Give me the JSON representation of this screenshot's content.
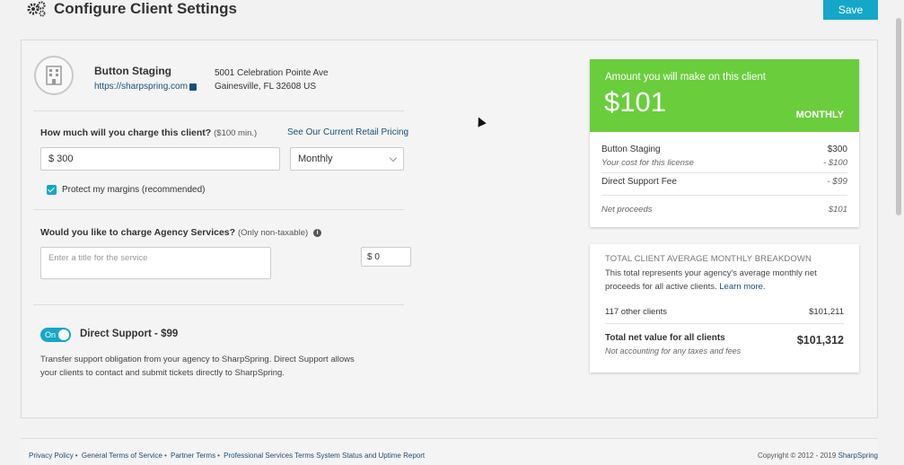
{
  "header": {
    "title": "Configure Client Settings",
    "save_label": "Save"
  },
  "client": {
    "name": "Button Staging",
    "url": "https://sharpspring.com",
    "address_line1": "5001 Celebration Pointe Ave",
    "address_line2": "Gainesville, FL 32608 US"
  },
  "charge": {
    "label": "How much will you charge this client?",
    "min_note": "($100 min.)",
    "pricing_link": "See Our Current Retail Pricing",
    "amount_value": "$ 300",
    "frequency_value": "Monthly",
    "protect_label": "Protect my margins (recommended)",
    "protect_checked": true
  },
  "agency": {
    "label": "Would you like to charge Agency Services?",
    "note": "(Only non-taxable)",
    "title_placeholder": "Enter a title for the service",
    "price_value": "$ 0"
  },
  "support": {
    "toggle_label": "On",
    "toggle_on": true,
    "title": "Direct Support - $99",
    "description": "Transfer support obligation from your agency to SharpSpring. Direct Support allows your clients to contact and submit tickets directly to SharpSpring."
  },
  "summary": {
    "title": "Amount you will make on this client",
    "amount": "$101",
    "period": "MONTHLY",
    "rows": [
      {
        "label": "Button Staging",
        "value": "$300"
      },
      {
        "label": "Your cost for this license",
        "value": "- $100"
      },
      {
        "label": "Direct Support Fee",
        "value": "- $99"
      },
      {
        "label": "Net proceeds",
        "value": "$101"
      }
    ]
  },
  "breakdown": {
    "title": "TOTAL CLIENT AVERAGE MONTHLY BREAKDOWN",
    "desc": "This total represents your agency's average monthly net proceeds for all active clients.",
    "learn_more": "Learn more.",
    "other_label": "117 other clients",
    "other_value": "$101,211",
    "total_label": "Total net value for all clients",
    "total_note": "Not accounting for any taxes and fees",
    "total_value": "$101,312"
  },
  "footer": {
    "links": [
      "Privacy Policy",
      "General Terms of Service",
      "Partner Terms",
      "Professional Services Terms",
      "System Status and Uptime Report"
    ],
    "copyright": "Copyright © 2012 - 2019",
    "brand": "SharpSpring"
  },
  "colors": {
    "accent": "#15a7c7",
    "green": "#6acd3c",
    "link": "#1a4e7a"
  }
}
